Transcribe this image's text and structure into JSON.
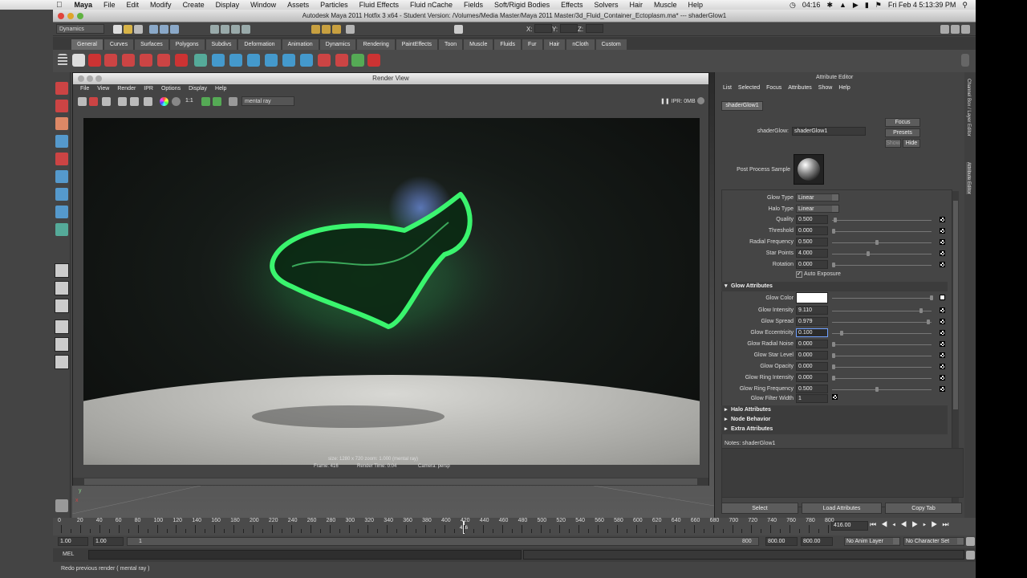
{
  "mac_menu": {
    "app": "Maya",
    "items": [
      "File",
      "Edit",
      "Modify",
      "Create",
      "Display",
      "Window",
      "Assets",
      "Particles",
      "Fluid Effects",
      "Fluid nCache",
      "Fields",
      "Soft/Rigid Bodies",
      "Effects",
      "Solvers",
      "Hair",
      "Muscle",
      "Help"
    ],
    "clock": "04:16",
    "datetime": "Fri Feb 4  5:13:39 PM"
  },
  "window_title": "Autodesk Maya 2011 Hotfix 3 x64 - Student Version: /Volumes/Media Master/Maya 2011 Master/3d_Fluid_Container_Ectoplasm.ma*  ---  shaderGlow1",
  "status_line": {
    "mode": "Dynamics",
    "x_label": "X:",
    "y_label": "Y:",
    "z_label": "Z:"
  },
  "shelf_tabs": [
    "General",
    "Curves",
    "Surfaces",
    "Polygons",
    "Subdivs",
    "Deformation",
    "Animation",
    "Dynamics",
    "Rendering",
    "PaintEffects",
    "Toon",
    "Muscle",
    "Fluids",
    "Fur",
    "Hair",
    "nCloth",
    "Custom"
  ],
  "render_view": {
    "title": "Render View",
    "menu": [
      "File",
      "View",
      "Render",
      "IPR",
      "Options",
      "Display",
      "Help"
    ],
    "renderer": "mental ray",
    "ratio": "1:1",
    "ipr_label": "IPR: 0MB",
    "info_line1": "size: 1280 x 720  zoom: 1.000          (mental ray)",
    "info_frame": "Frame: 416",
    "info_time": "Render Time: 0:04",
    "info_camera": "Camera: persp"
  },
  "attr_editor": {
    "title": "Attribute Editor",
    "menu": [
      "List",
      "Selected",
      "Focus",
      "Attributes",
      "Show",
      "Help"
    ],
    "node_tab": "shaderGlow1",
    "node_label": "shaderGlow:",
    "node_value": "shaderGlow1",
    "focus": "Focus",
    "presets": "Presets",
    "show": "Show",
    "hide": "Hide",
    "sample_label": "Post Process Sample",
    "glow_type_label": "Glow Type",
    "glow_type": "Linear",
    "halo_type_label": "Halo Type",
    "halo_type": "Linear",
    "top_attrs": [
      {
        "label": "Quality",
        "value": "0.500",
        "level": 0.02
      },
      {
        "label": "Threshold",
        "value": "0.000",
        "level": 0.0
      },
      {
        "label": "Radial Frequency",
        "value": "0.500",
        "level": 0.45
      },
      {
        "label": "Star Points",
        "value": "4.000",
        "level": 0.36
      },
      {
        "label": "Rotation",
        "value": "0.000",
        "level": 0.0
      }
    ],
    "auto_exposure": "Auto Exposure",
    "glow_section": "Glow Attributes",
    "glow_color_label": "Glow Color",
    "glow_color": "#ffffff",
    "glow_attrs": [
      {
        "label": "Glow Intensity",
        "value": "9.110",
        "level": 0.91
      },
      {
        "label": "Glow Spread",
        "value": "0.979",
        "level": 0.98
      },
      {
        "label": "Glow Eccentricity",
        "value": "0.100",
        "level": 0.08
      },
      {
        "label": "Glow Radial Noise",
        "value": "0.000",
        "level": 0.0
      },
      {
        "label": "Glow Star Level",
        "value": "0.000",
        "level": 0.0
      },
      {
        "label": "Glow Opacity",
        "value": "0.000",
        "level": 0.0
      },
      {
        "label": "Glow Ring Intensity",
        "value": "0.000",
        "level": 0.0
      },
      {
        "label": "Glow Ring Frequency",
        "value": "0.500",
        "level": 0.45
      }
    ],
    "filter_width_label": "Glow Filter Width",
    "filter_width": "1",
    "halo_section": "Halo Attributes",
    "node_behavior": "Node Behavior",
    "extra_attrs": "Extra Attributes",
    "notes": "Notes:  shaderGlow1",
    "btn_select": "Select",
    "btn_load": "Load Attributes",
    "btn_copy": "Copy Tab",
    "side_tabs": [
      "Channel Box / Layer Editor",
      "Attribute Editor"
    ]
  },
  "time_slider": {
    "ticks": [
      "0",
      "20",
      "40",
      "60",
      "80",
      "100",
      "120",
      "140",
      "160",
      "180",
      "200",
      "220",
      "240",
      "260",
      "280",
      "300",
      "320",
      "340",
      "360",
      "380",
      "400",
      "420",
      "440",
      "460",
      "480",
      "500",
      "520",
      "540",
      "560",
      "580",
      "600",
      "620",
      "640",
      "660",
      "680",
      "700",
      "720",
      "740",
      "760",
      "780",
      "800"
    ],
    "current_frame": "416.00",
    "playhead_label": "416"
  },
  "range": {
    "start": "1.00",
    "start2": "1.00",
    "range_start": "1",
    "range_end": "800",
    "end1": "800.00",
    "end2": "800.00",
    "anim_layer": "No Anim Layer",
    "char_set": "No Character Set"
  },
  "cmd": {
    "label": "MEL"
  },
  "help_line": "Redo previous render ( mental ray )"
}
